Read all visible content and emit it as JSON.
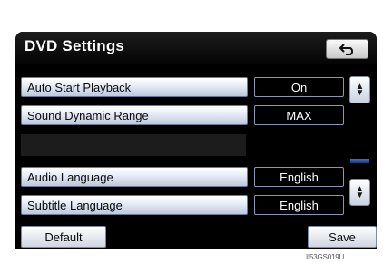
{
  "screen": {
    "title": "DVD Settings",
    "back_icon": "back-arrow-icon"
  },
  "settings": [
    {
      "label": "Auto Start Playback",
      "value": "On"
    },
    {
      "label": "Sound Dynamic Range",
      "value": "MAX"
    },
    {
      "label": "Audio Language",
      "value": "English"
    },
    {
      "label": "Subtitle Language",
      "value": "English"
    }
  ],
  "footer": {
    "default_label": "Default",
    "save_label": "Save"
  },
  "caption": "II53GS019U",
  "colors": {
    "screen_bg": "#000000",
    "button_face": "#e8eef8",
    "value_border": "#8796b2",
    "scroll_thumb": "#2c5aa8"
  }
}
